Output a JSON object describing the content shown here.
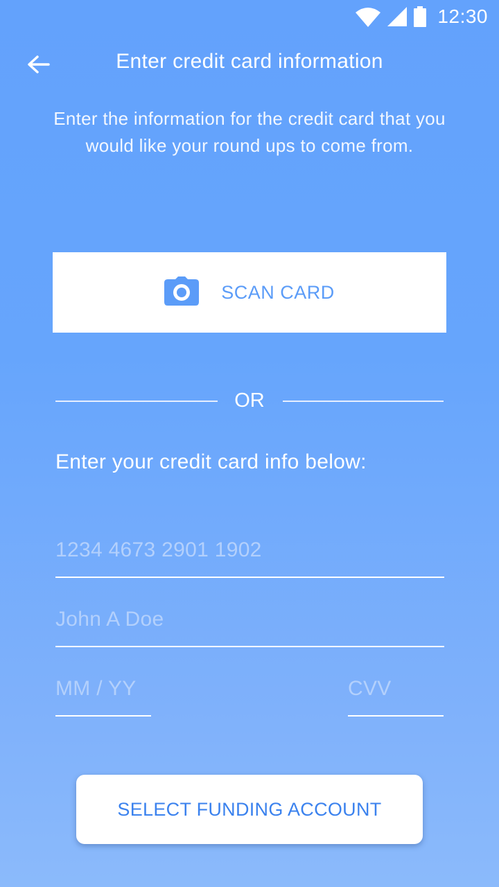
{
  "status_bar": {
    "time": "12:30",
    "icons": [
      "wifi-icon",
      "signal-icon",
      "battery-icon"
    ]
  },
  "header": {
    "title": "Enter credit card information",
    "back_icon": "arrow-left-icon"
  },
  "intro": {
    "text": "Enter the information for the credit card that you would like your round ups to come from."
  },
  "scan_card": {
    "label": "SCAN CARD",
    "icon": "camera-icon"
  },
  "divider": {
    "label": "OR"
  },
  "form": {
    "heading": "Enter your credit card info below:",
    "card_number": {
      "value": "",
      "placeholder": "1234 4673 2901 1902"
    },
    "name": {
      "value": "",
      "placeholder": "John A Doe"
    },
    "expiry": {
      "value": "",
      "placeholder": "MM / YY"
    },
    "cvv": {
      "value": "",
      "placeholder": "CVV"
    }
  },
  "footer": {
    "button_label": "SELECT FUNDING ACCOUNT"
  },
  "colors": {
    "background_top": "#63a2fc",
    "background_bottom": "#8bbafb",
    "accent": "#5b9cf8",
    "button_text": "#3b82ee"
  }
}
